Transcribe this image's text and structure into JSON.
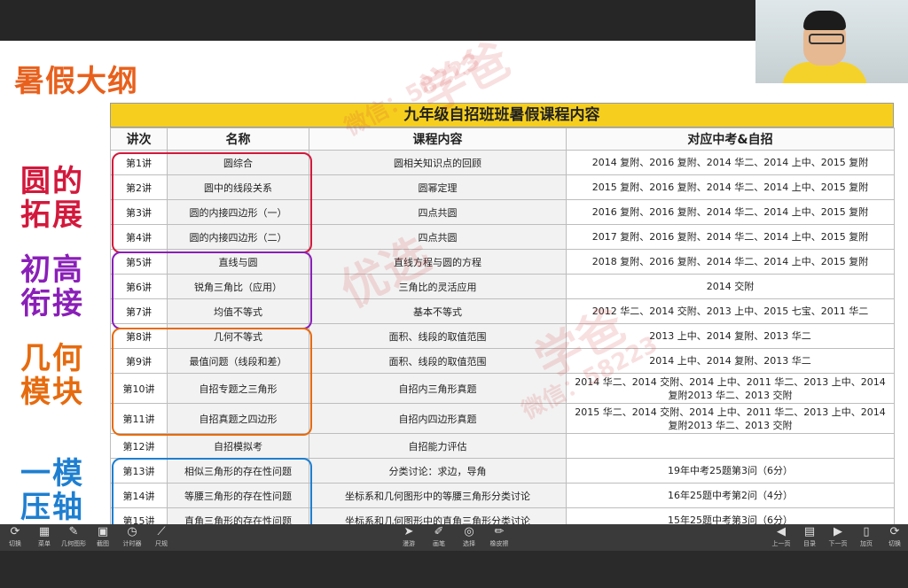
{
  "slide": {
    "title": "暑假大纲",
    "side_labels": [
      "圆的拓展",
      "初高衔接",
      "几何模块",
      "一模压轴"
    ]
  },
  "table": {
    "title": "九年级自招班班暑假课程内容",
    "headers": [
      "讲次",
      "名称",
      "课程内容",
      "对应中考&自招"
    ],
    "rows": [
      {
        "no": "第1讲",
        "name": "圆综合",
        "content": "圆相关知识点的回顾",
        "ref": "2014 复附、2016 复附、2014 华二、2014 上中、2015 复附"
      },
      {
        "no": "第2讲",
        "name": "圆中的线段关系",
        "content": "圆幂定理",
        "ref": "2015 复附、2016 复附、2014 华二、2014 上中、2015 复附"
      },
      {
        "no": "第3讲",
        "name": "圆的内接四边形（一）",
        "content": "四点共圆",
        "ref": "2016 复附、2016 复附、2014 华二、2014 上中、2015 复附"
      },
      {
        "no": "第4讲",
        "name": "圆的内接四边形（二）",
        "content": "四点共圆",
        "ref": "2017 复附、2016 复附、2014 华二、2014 上中、2015 复附"
      },
      {
        "no": "第5讲",
        "name": "直线与圆",
        "content": "直线方程与圆的方程",
        "ref": "2018 复附、2016 复附、2014 华二、2014 上中、2015 复附"
      },
      {
        "no": "第6讲",
        "name": "锐角三角比（应用）",
        "content": "三角比的灵活应用",
        "ref": "2014 交附"
      },
      {
        "no": "第7讲",
        "name": "均值不等式",
        "content": "基本不等式",
        "ref": "2012 华二、2014 交附、2013 上中、2015 七宝、2011 华二"
      },
      {
        "no": "第8讲",
        "name": "几何不等式",
        "content": "面积、线段的取值范围",
        "ref": "2013 上中、2014 复附、2013 华二"
      },
      {
        "no": "第9讲",
        "name": "最值问题（线段和差）",
        "content": "面积、线段的取值范围",
        "ref": "2014 上中、2014 复附、2013 华二"
      },
      {
        "no": "第10讲",
        "name": "自招专题之三角形",
        "content": "自招内三角形真题",
        "ref": "2014 华二、2014 交附、2014 上中、2011 华二、2013 上中、2014 复附2013 华二、2013 交附"
      },
      {
        "no": "第11讲",
        "name": "自招真题之四边形",
        "content": "自招内四边形真题",
        "ref": "2015 华二、2014 交附、2014 上中、2011 华二、2013 上中、2014 复附2013 华二、2013 交附"
      },
      {
        "no": "第12讲",
        "name": "自招模拟考",
        "content": "自招能力评估",
        "ref": ""
      },
      {
        "no": "第13讲",
        "name": "相似三角形的存在性问题",
        "content": "分类讨论：求边，导角",
        "ref": "19年中考25题第3问（6分）"
      },
      {
        "no": "第14讲",
        "name": "等腰三角形的存在性问题",
        "content": "坐标系和几何图形中的等腰三角形分类讨论",
        "ref": "16年25题中考第2问（4分）"
      },
      {
        "no": "第15讲",
        "name": "直角三角形的存在性问题",
        "content": "坐标系和几何图形中的直角三角形分类讨论",
        "ref": "15年25题中考第3问（6分）"
      }
    ]
  },
  "watermark": {
    "a": "学爸",
    "b": "微信：58223",
    "c": "优选"
  },
  "toolbar": {
    "left": [
      {
        "icon": "rotate-icon",
        "glyph": "⟳",
        "label": "切换"
      },
      {
        "icon": "grid-icon",
        "glyph": "▦",
        "label": "菜单"
      },
      {
        "icon": "ruler-pen-icon",
        "glyph": "✎",
        "label": "几何图形"
      },
      {
        "icon": "image-icon",
        "glyph": "▣",
        "label": "截图"
      },
      {
        "icon": "timer-icon",
        "glyph": "◷",
        "label": "计时器"
      },
      {
        "icon": "ruler-icon",
        "glyph": "⟋",
        "label": "尺规"
      }
    ],
    "center": [
      {
        "icon": "pointer-icon",
        "glyph": "➤",
        "label": "漫游"
      },
      {
        "icon": "pen-icon",
        "glyph": "✐",
        "label": "画笔"
      },
      {
        "icon": "select-icon",
        "glyph": "◎",
        "label": "选择"
      },
      {
        "icon": "eraser-icon",
        "glyph": "✏",
        "label": "橡皮擦"
      }
    ],
    "right": [
      {
        "icon": "prev-page-icon",
        "glyph": "◀",
        "label": "上一页"
      },
      {
        "icon": "page-list-icon",
        "glyph": "▤",
        "label": "目录"
      },
      {
        "icon": "next-page-icon",
        "glyph": "▶",
        "label": "下一页"
      },
      {
        "icon": "add-page-icon",
        "glyph": "▯",
        "label": "加页"
      },
      {
        "icon": "refresh-icon",
        "glyph": "⟳",
        "label": "切换"
      }
    ]
  }
}
